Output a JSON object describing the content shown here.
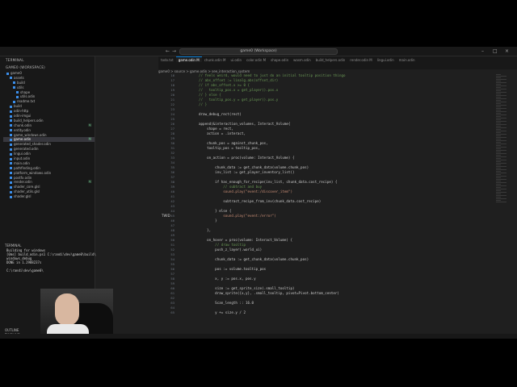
{
  "window": {
    "title": "game0 (Workspace)",
    "nav_back": "←",
    "nav_fwd": "→"
  },
  "sidebar": {
    "explorer_label": "TERMINAL",
    "workspace_label": "GAME0 (WORKSPACE)",
    "tree": [
      {
        "label": "game0",
        "git": ""
      },
      {
        "label": "assets",
        "git": ""
      },
      {
        "label": "build",
        "git": ""
      },
      {
        "label": "utils",
        "git": ""
      },
      {
        "label": "shape",
        "git": ""
      },
      {
        "label": "utils.odin",
        "git": ""
      },
      {
        "label": "readme.txt",
        "git": ""
      },
      {
        "label": "build",
        "git": ""
      },
      {
        "label": "odin-http",
        "git": ""
      },
      {
        "label": "odin-imgui",
        "git": ""
      },
      {
        "label": "build_helpers.odin",
        "git": ""
      },
      {
        "label": "chunk.odin",
        "git": "M"
      },
      {
        "label": "entity.odin",
        "git": ""
      },
      {
        "label": "game_windows.odin",
        "git": ""
      },
      {
        "label": "game.odin",
        "git": "M"
      },
      {
        "label": "generated_shader.odin",
        "git": ""
      },
      {
        "label": "generated.odin",
        "git": ""
      },
      {
        "label": "lingui.odin",
        "git": ""
      },
      {
        "label": "input.odin",
        "git": ""
      },
      {
        "label": "main.odin",
        "git": ""
      },
      {
        "label": "pathfinding.odin",
        "git": ""
      },
      {
        "label": "platform_windows.odin",
        "git": ""
      },
      {
        "label": "postfx.odin",
        "git": ""
      },
      {
        "label": "render.odin",
        "git": "M"
      },
      {
        "label": "shader_core.glsl",
        "git": ""
      },
      {
        "label": "shader_utils.glsl",
        "git": ""
      },
      {
        "label": "shader.glsl",
        "git": ""
      }
    ],
    "terminal_label": "TERMINAL",
    "terminal_lines": [
      "Building for windows",
      "[0ms] build_odin.ps1 C:\\randi\\dev\\game0\\build\\",
      "windows_debug",
      "DONE in 1.2988237s",
      "",
      "C:\\randi\\dev\\game0\\"
    ],
    "outline_label": "OUTLINE",
    "timeline_label": "TIMELINE"
  },
  "tabs": [
    {
      "label": "todo.txt",
      "active": false
    },
    {
      "label": "game.odin M",
      "active": true
    },
    {
      "label": "chunk.odin M",
      "active": false
    },
    {
      "label": "ui.odin",
      "active": false
    },
    {
      "label": "color.odin M",
      "active": false
    },
    {
      "label": "shape.odin",
      "active": false
    },
    {
      "label": "wasm.odin",
      "active": false
    },
    {
      "label": "build_helpers.odin",
      "active": false
    },
    {
      "label": "render.odin M",
      "active": false
    },
    {
      "label": "lingui.odin",
      "active": false
    },
    {
      "label": "main.odin",
      "active": false
    }
  ],
  "breadcrumb": "game0 > source > game.odin > see_interaction_system",
  "editor": {
    "line_numbers": [
      "16",
      "17",
      "18",
      "19",
      "20",
      "21",
      "22",
      "23",
      "24",
      "25",
      "26",
      "27",
      "28",
      "29",
      "30",
      "31",
      "32",
      "33",
      "34",
      "35",
      "36",
      "37",
      "38",
      "39",
      "40",
      "41",
      "42",
      "43",
      "44",
      "45",
      "46",
      "47",
      "48",
      "49",
      "50",
      "51",
      "52",
      "53",
      "54",
      "55",
      "56",
      "57",
      "58",
      "59",
      "60",
      "61",
      "62",
      "63",
      "64",
      "65",
      "66",
      "67",
      "68",
      "69",
      "70",
      "71",
      "72",
      "73",
      "74",
      "75"
    ],
    "lines": [
      "// feels weird, would need to just do an initial tooltip position thingo",
      "// abs_offset := linalg.abs(offset_dir)",
      "// if abs_offset.x >= 0 {",
      "//   tooltip_pos.x = get_player().pos.x",
      "// } else {",
      "//   tooltip_pos.y = get_player().pos.y",
      "// }",
      "",
      "draw_debug_rect(rect)",
      "",
      "append(&interaction_volumes, Interact_Volume{",
      "    shape = rect,",
      "    action = .interact,",
      "",
      "    chunk_pos = against_chunk_pos,",
      "    tooltip_pos = tooltip_pos,",
      "",
      "    on_action = proc(volume: Interact_Volume) {",
      "",
      "        chunk_data := get_chunk_data(volume.chunk_pos)",
      "        inv_list := get_player_inventory_list()",
      "",
      "        if has_enough_for_recipe(inv_list, chunk_data.cost_recipe) {",
      "            // subtract and buy",
      "            sound.play(\"event:/discover_item\")",
      "",
      "            subtract_recipe_from_inv(chunk_data.cost_recipe)",
      "",
      "        } else {",
      "            sound.play(\"event:/error\")",
      "        }",
      "",
      "    },",
      "",
      "    on_hover = proc(volume: Interact_Volume) {",
      "        // draw tooltip",
      "        push_z_layer(.world_ui)",
      "",
      "        chunk_data := get_chunk_data(volume.chunk_pos)",
      "",
      "        pos := volume.tooltip_pos",
      "",
      "        x, y := pos.x, pos.y",
      "",
      "        size := get_sprite_size(.small_tooltip)",
      "        draw_sprite({x,y}, .small_tooltip, pivot=Pivot.bottom_center)",
      "",
      "        Scan_length :: 16.0",
      "",
      "        y += size.y / 2"
    ],
    "twid_label": "TWID",
    "twid_line": 44
  }
}
